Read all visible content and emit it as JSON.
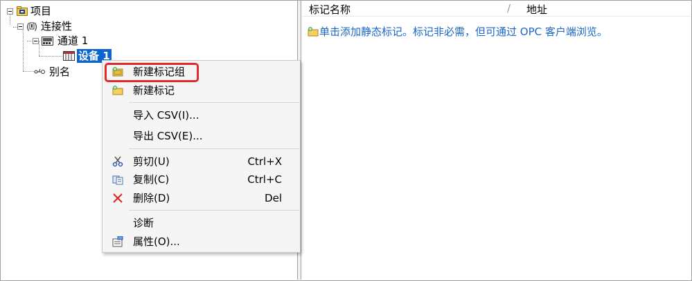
{
  "tree": {
    "root": "项目",
    "connectivity": "连接性",
    "channel": "通道 1",
    "device": "设备 1",
    "alias": "别名"
  },
  "list": {
    "col_tag_name": "标记名称",
    "sort_indicator": "/",
    "col_address": "地址",
    "hint": "单击添加静态标记。标记非必需，但可通过 OPC 客户端浏览。"
  },
  "context_menu": {
    "new_tag_group": "新建标记组",
    "new_tag": "新建标记",
    "import_csv": "导入 CSV(I)...",
    "export_csv": "导出 CSV(E)...",
    "cut": "剪切(U)",
    "cut_shortcut": "Ctrl+X",
    "copy": "复制(C)",
    "copy_shortcut": "Ctrl+C",
    "delete": "删除(D)",
    "delete_shortcut": "Del",
    "diagnostics": "诊断",
    "properties": "属性(O)..."
  },
  "colors": {
    "selection": "#0a64d2",
    "hint_text": "#1a66c9",
    "highlight_box": "#e32a2a"
  }
}
